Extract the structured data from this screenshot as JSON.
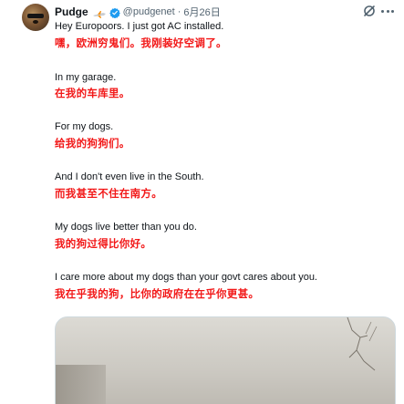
{
  "tweet": {
    "display_name": "Pudge",
    "name_emoji": "airplane-emoji",
    "handle": "@pudgenet",
    "separator": "·",
    "date": "6月26日",
    "lines": [
      {
        "text": "Hey Europoors. I just got AC installed.",
        "lang": "en"
      },
      {
        "text": "嘿，欧洲穷鬼们。我刚装好空调了。",
        "lang": "zh"
      },
      {
        "text": "In my garage.",
        "lang": "en"
      },
      {
        "text": "在我的车库里。",
        "lang": "zh"
      },
      {
        "text": "For my dogs.",
        "lang": "en"
      },
      {
        "text": "给我的狗狗们。",
        "lang": "zh"
      },
      {
        "text": "And I don't even live in the South.",
        "lang": "en"
      },
      {
        "text": "而我甚至不住在南方。",
        "lang": "zh"
      },
      {
        "text": "My dogs live better than you do.",
        "lang": "en"
      },
      {
        "text": "我的狗过得比你好。",
        "lang": "zh"
      },
      {
        "text": "I care more about my dogs than your govt cares about you.",
        "lang": "en"
      },
      {
        "text": "我在乎我的狗，比你的政府在在乎你更甚。",
        "lang": "zh"
      }
    ]
  },
  "icons": {
    "verified": "verified-badge-icon",
    "grok": "grok-icon",
    "more": "more-options-icon"
  },
  "colors": {
    "text_primary": "#0f1419",
    "text_secondary": "#536471",
    "translation": "#f21818",
    "verified": "#1d9bf0"
  }
}
